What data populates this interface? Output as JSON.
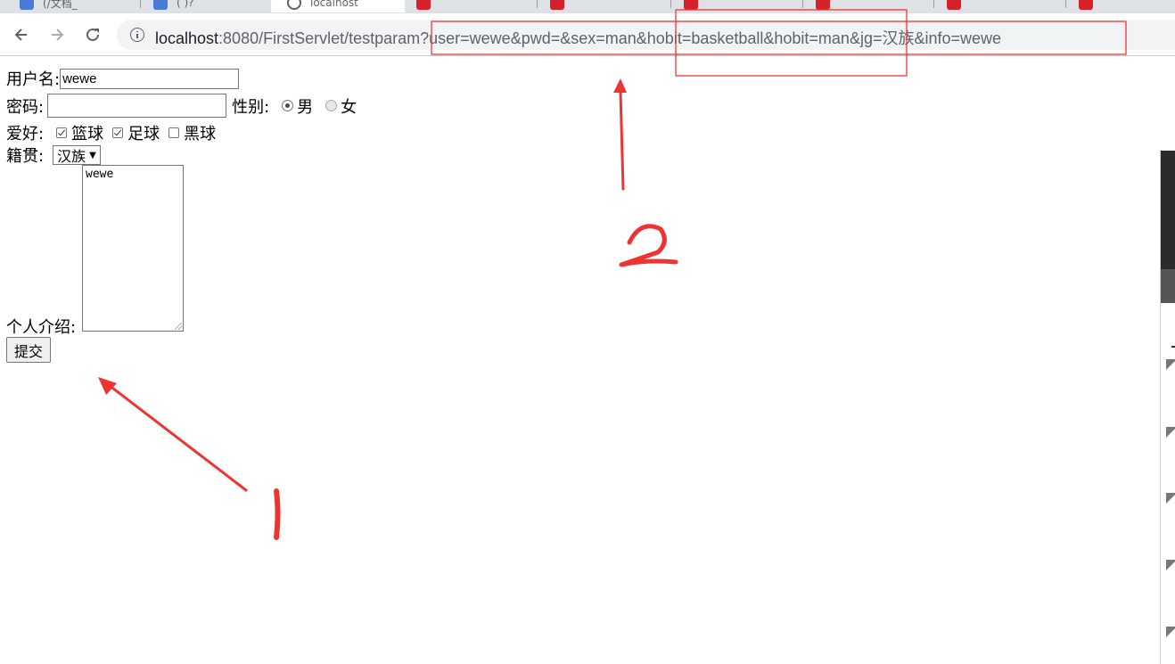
{
  "browser": {
    "tabs": [
      {
        "title": "(/文档_ ",
        "icon": "blue-page-icon"
      },
      {
        "title": "( )? ",
        "icon": "blue-page-icon"
      },
      {
        "title": "localhost",
        "icon": "info-circle-icon"
      },
      {
        "title": "",
        "icon": "csdn-icon"
      },
      {
        "title": "",
        "icon": "csdn-icon"
      },
      {
        "title": "",
        "icon": "csdn-icon"
      },
      {
        "title": "",
        "icon": "csdn-icon"
      },
      {
        "title": "",
        "icon": "csdn-icon"
      },
      {
        "title": "",
        "icon": "csdn-icon"
      }
    ],
    "url_host": "localhost",
    "url_rest": ":8080/FirstServlet/testparam?user=wewe&pwd=&sex=man&hobit=basketball&hobit=man&jg=汉族&info=wewe"
  },
  "form": {
    "username_label": "用户名:",
    "username_value": "wewe",
    "password_label": "密码:",
    "password_value": "",
    "gender_label": "性别:",
    "gender_male": "男",
    "gender_female": "女",
    "gender_selected": "男",
    "hobby_label": "爱好:",
    "hobby_basketball": "篮球",
    "hobby_football": "足球",
    "hobby_black": "黑球",
    "hobby_checked": [
      "篮球",
      "足球"
    ],
    "origin_label": "籍贯:",
    "origin_value": "汉族",
    "intro_label": "个人介绍:",
    "intro_value": "wewe",
    "submit_label": "提交"
  },
  "annotations": {
    "colors": {
      "annotation": "#ee3333"
    }
  }
}
